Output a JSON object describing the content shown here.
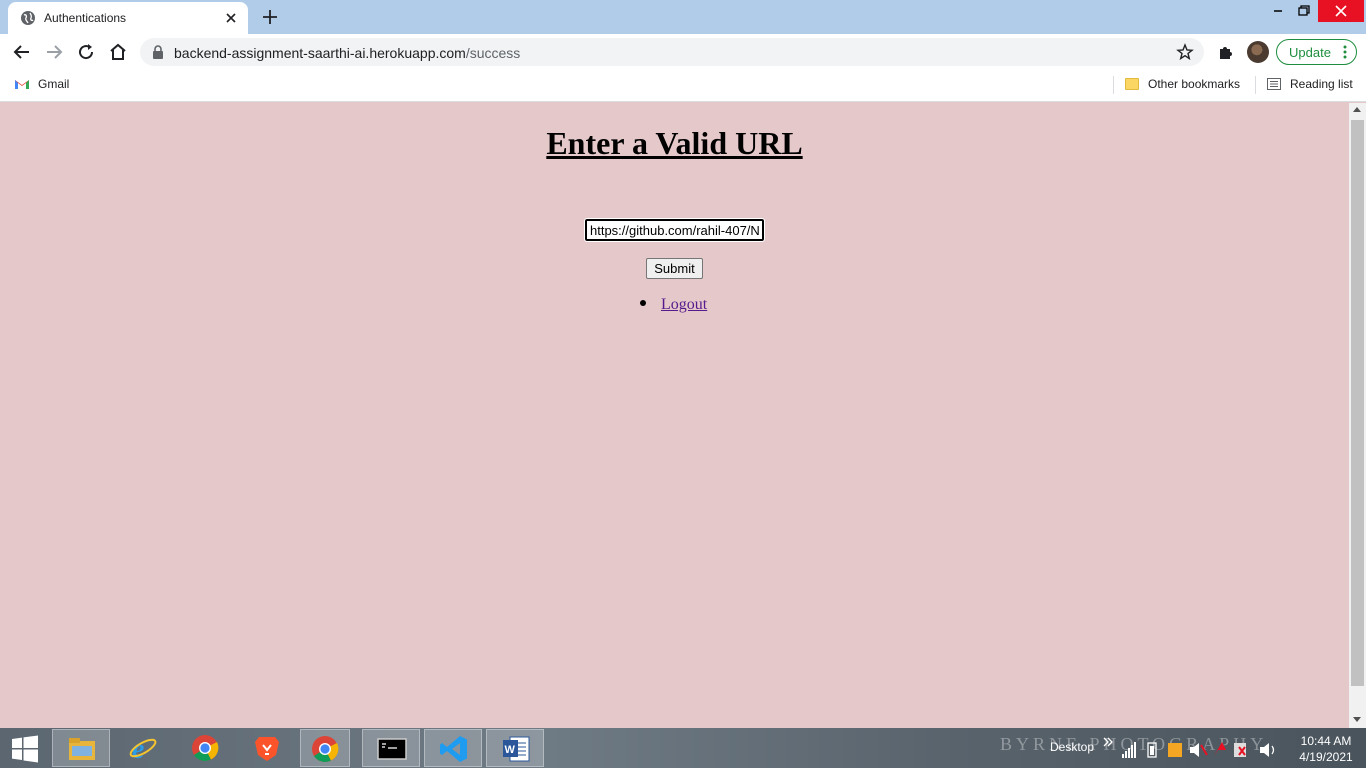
{
  "browser": {
    "tab_title": "Authentications",
    "url_domain": "backend-assignment-saarthi-ai.herokuapp.com",
    "url_path": "/success",
    "update_label": "Update"
  },
  "bookmarks": {
    "gmail": "Gmail",
    "other": "Other bookmarks",
    "reading_list": "Reading list"
  },
  "page": {
    "heading": "Enter a Valid URL",
    "url_value": "https://github.com/rahil-407/N",
    "submit_label": "Submit",
    "logout_label": "Logout"
  },
  "taskbar": {
    "watermark": "BYRNE PHOTOGRAPHY",
    "desktop_label": "Desktop",
    "time": "10:44 AM",
    "date": "4/19/2021"
  },
  "colors": {
    "page_bg": "#e5c8ca",
    "tabstrip": "#b1cce8",
    "update_green": "#1e8e3e",
    "link_visited": "#551a8b"
  }
}
